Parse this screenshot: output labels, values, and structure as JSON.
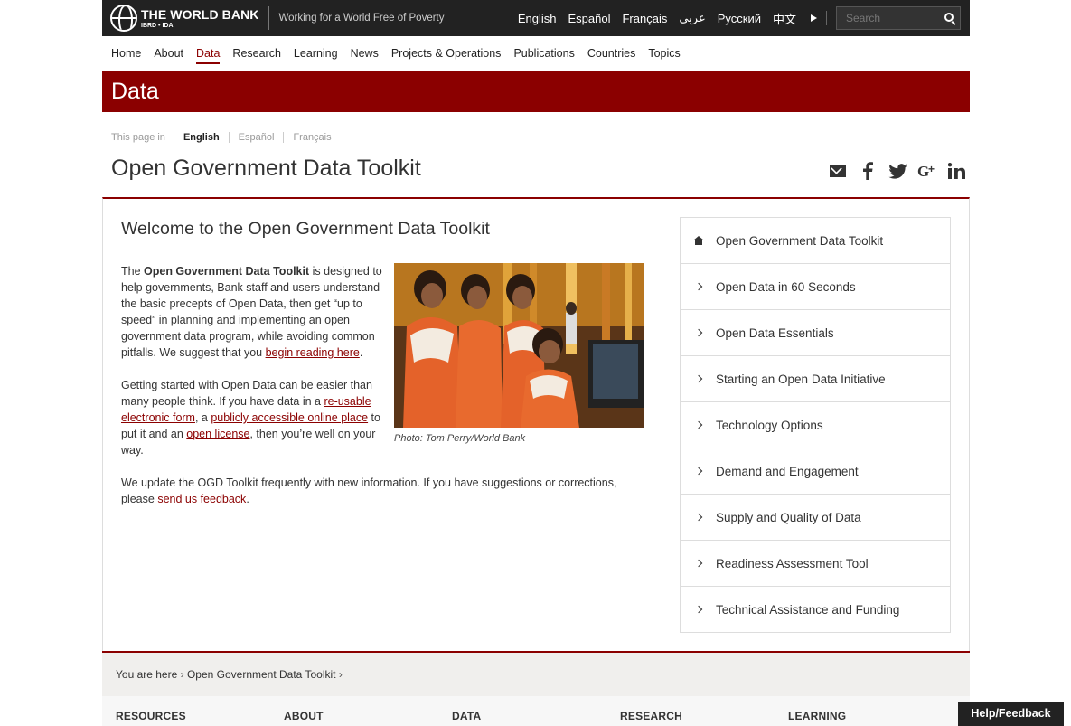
{
  "topbar": {
    "logo_name": "THE WORLD BANK",
    "logo_sub": "IBRD • IDA",
    "tagline": "Working for a World Free of Poverty",
    "languages": [
      "English",
      "Español",
      "Français",
      "عربي",
      "Русский",
      "中文"
    ],
    "search_placeholder": "Search"
  },
  "nav": [
    "Home",
    "About",
    "Data",
    "Research",
    "Learning",
    "News",
    "Projects & Operations",
    "Publications",
    "Countries",
    "Topics"
  ],
  "banner_title": "Data",
  "page_lang": {
    "label": "This page in",
    "options": [
      "English",
      "Español",
      "Français"
    ]
  },
  "page_title": "Open Government Data Toolkit",
  "main": {
    "heading": "Welcome to the Open Government Data Toolkit",
    "p1_a": "The ",
    "p1_bold": "Open Government Data Toolkit",
    "p1_b": " is designed to help governments, Bank staff and users understand the basic precepts of Open Data, then get “up to speed” in planning and implementing an open government data program, while avoiding common pitfalls. We suggest that you ",
    "p1_link": "begin reading here",
    "p1_c": ".",
    "p2_a": "Getting started with Open Data can be easier than many people think. If you have data in a ",
    "p2_link1": "re-usable electronic form",
    "p2_b": ", a ",
    "p2_link2": "publicly accessible online place",
    "p2_c": " to put it and an ",
    "p2_link3": "open license",
    "p2_d": ", then you’re well on your way.",
    "p3_a": "We update the OGD Toolkit frequently with new information. If you have suggestions or corrections, please ",
    "p3_link": "send us feedback",
    "p3_b": ".",
    "caption": "Photo: Tom Perry/World Bank"
  },
  "sidenav": [
    "Open Government Data Toolkit",
    "Open Data in 60 Seconds",
    "Open Data Essentials",
    "Starting an Open Data Initiative",
    "Technology Options",
    "Demand and Engagement",
    "Supply and Quality of Data",
    "Readiness Assessment Tool",
    "Technical Assistance and Funding"
  ],
  "breadcrumb": {
    "prefix": "You are here",
    "current": "Open Government Data Toolkit"
  },
  "footer": [
    "RESOURCES",
    "ABOUT",
    "DATA",
    "RESEARCH",
    "LEARNING"
  ],
  "help_label": "Help/Feedback"
}
